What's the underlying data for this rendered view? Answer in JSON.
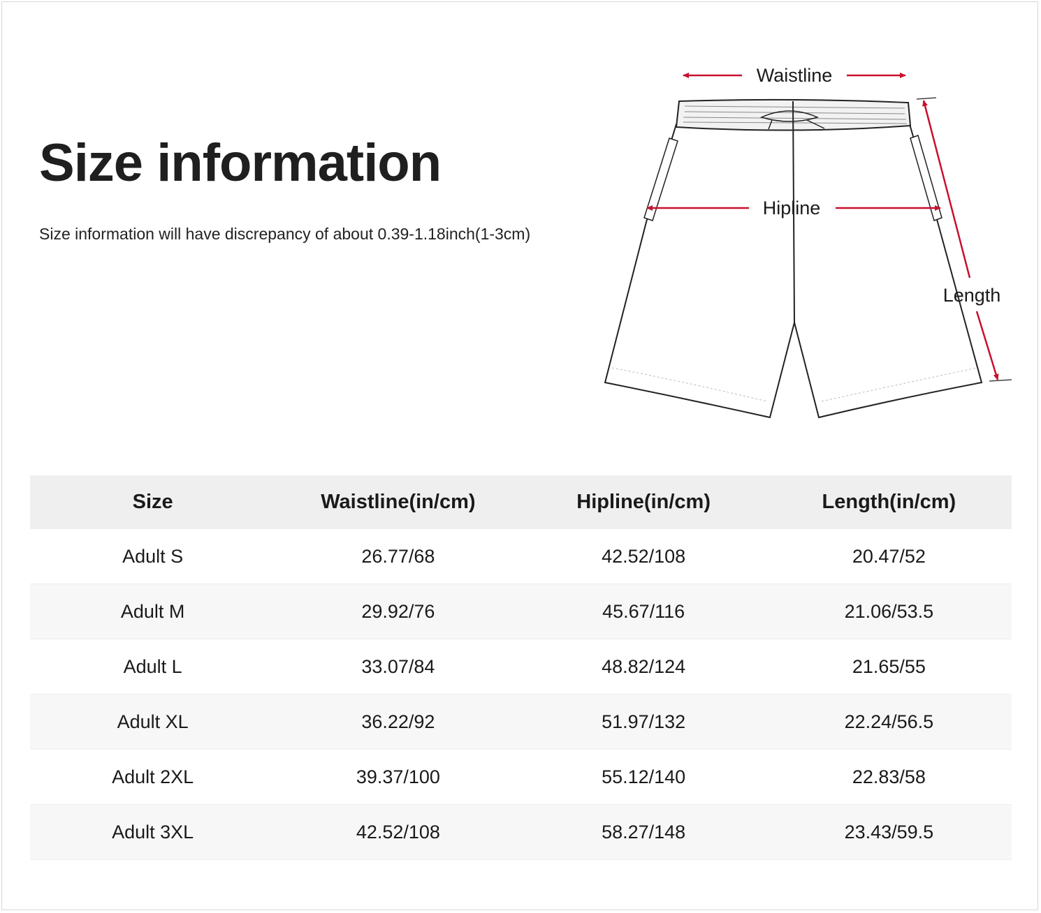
{
  "header": {
    "title": "Size information",
    "subtitle": "Size information will have discrepancy of about 0.39-1.18inch(1-3cm)"
  },
  "diagram": {
    "labels": {
      "waistline": "Waistline",
      "hipline": "Hipline",
      "length": "Length"
    },
    "arrow_color": "#c8102e"
  },
  "table": {
    "columns": [
      "Size",
      "Waistline(in/cm)",
      "Hipline(in/cm)",
      "Length(in/cm)"
    ],
    "rows": [
      [
        "Adult S",
        "26.77/68",
        "42.52/108",
        "20.47/52"
      ],
      [
        "Adult M",
        "29.92/76",
        "45.67/116",
        "21.06/53.5"
      ],
      [
        "Adult L",
        "33.07/84",
        "48.82/124",
        "21.65/55"
      ],
      [
        "Adult XL",
        "36.22/92",
        "51.97/132",
        "22.24/56.5"
      ],
      [
        "Adult 2XL",
        "39.37/100",
        "55.12/140",
        "22.83/58"
      ],
      [
        "Adult 3XL",
        "42.52/108",
        "58.27/148",
        "23.43/59.5"
      ]
    ]
  }
}
